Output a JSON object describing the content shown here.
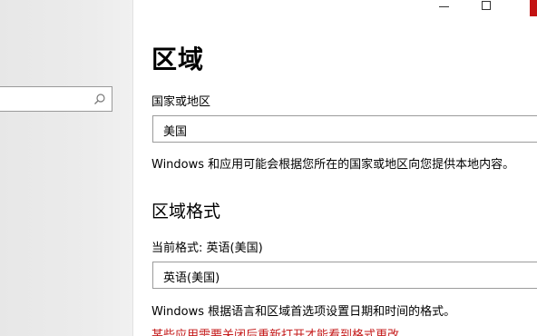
{
  "window": {
    "minimize_label": "",
    "maximize_label": "",
    "accent_close": "#c31313"
  },
  "sidebar": {
    "search": {
      "value": "",
      "icon": "search-icon"
    }
  },
  "main": {
    "title": "区域",
    "country": {
      "label": "国家或地区",
      "value": "美国",
      "description": "Windows 和应用可能会根据您所在的国家或地区向您提供本地内容。"
    },
    "format": {
      "heading": "区域格式",
      "current_label": "当前格式: 英语(美国)",
      "value": "英语(美国)",
      "description": "Windows 根据语言和区域首选项设置日期和时间的格式。",
      "warning": "某些应用需要关闭后重新打开才能看到格式更改",
      "warning_color": "#c41a1a"
    }
  }
}
